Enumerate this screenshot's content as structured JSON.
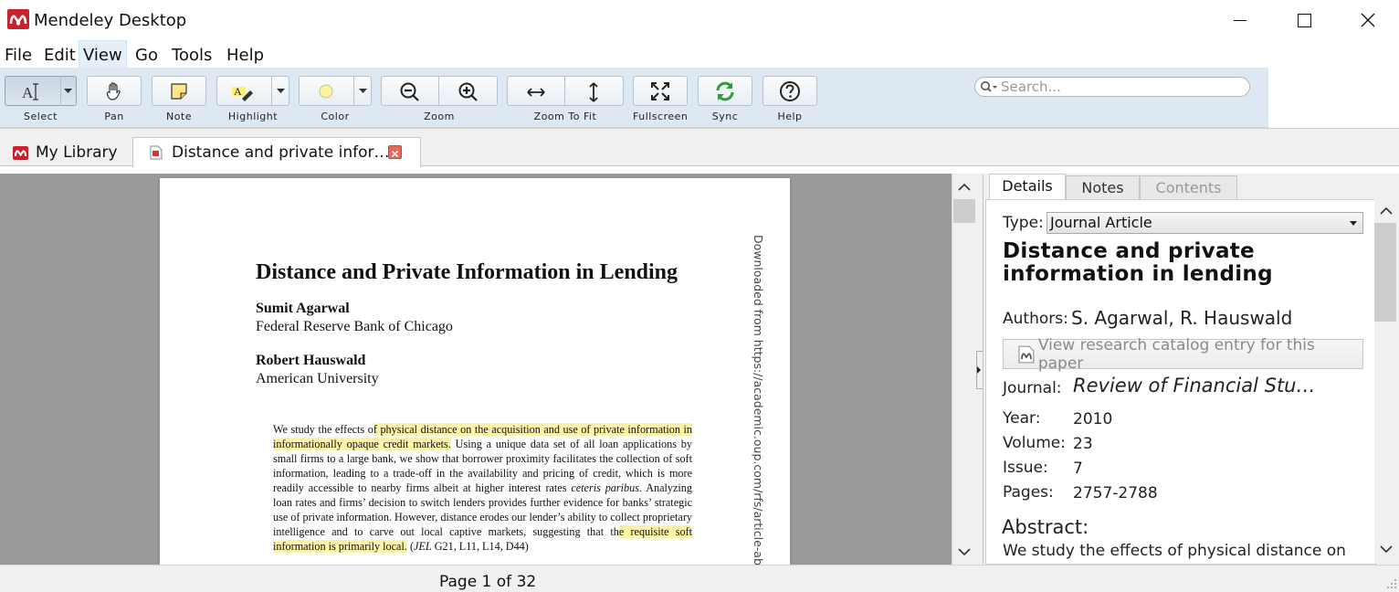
{
  "window": {
    "title": "Mendeley Desktop",
    "minimize_glyph": "─",
    "maximize_glyph": "☐",
    "close_glyph": "✕"
  },
  "menu": {
    "items": [
      "File",
      "Edit",
      "View",
      "Go",
      "Tools",
      "Help"
    ],
    "active": "View"
  },
  "toolbar": {
    "select": "Select",
    "pan": "Pan",
    "note": "Note",
    "highlight": "Highlight",
    "color": "Color",
    "zoom": "Zoom",
    "zoom_to_fit": "Zoom To Fit",
    "fullscreen": "Fullscreen",
    "sync": "Sync",
    "help": "Help",
    "highlight_color": "#fff3a0",
    "sync_color": "#2e9c3a"
  },
  "search": {
    "placeholder": "Search..."
  },
  "tabs": {
    "library": "My Library",
    "document": "Distance and private infor…"
  },
  "document": {
    "title": "Distance and Private Information in Lending",
    "author1_name": "Sumit Agarwal",
    "author1_affil": "Federal Reserve Bank of Chicago",
    "author2_name": "Robert Hauswald",
    "author2_affil": "American University",
    "abstract": {
      "a1": "We study the effects o",
      "h1": "f physical distance on the acquisition and use of private information in informationally opaque credit markets.",
      "a2": " Using a unique data set of all loan applications by small firms to a large bank, we show that borrower proximity facilitates the collection of soft information, leading to a trade-off in the availability and pricing of credit, which is more readily accessible to nearby firms albeit at higher interest rates ",
      "a2i": "ceteris paribus",
      "a3": ". Analyzing loan rates and firms’ decision to switch lenders provides further evidence for banks’ strategic use of private information. However, distance erodes our lender’s ability to collect proprietary intelligence and to carve out local captive markets, suggesting that th",
      "h2": "e requisite soft information is primarily local.",
      "a4": " (",
      "a4i": "JEL",
      "a5": " G21, L11, L14, D44)"
    },
    "side_watermark": "Downloaded from https://academic.oup.com/rfs/article-abstract/"
  },
  "status": {
    "page": "Page 1 of 32"
  },
  "details": {
    "tabs": [
      "Details",
      "Notes",
      "Contents"
    ],
    "type_label": "Type:",
    "type_value": "Journal Article",
    "title": "Distance and private information in lending",
    "authors_label": "Authors:",
    "authors_value": "S. Agarwal, R. Hauswald",
    "catalog_button": "View research catalog entry for this paper",
    "journal_label": "Journal:",
    "journal_value": "Review of Financial Stu…",
    "year_label": "Year:",
    "year_value": "2010",
    "volume_label": "Volume:",
    "volume_value": "23",
    "issue_label": "Issue:",
    "issue_value": "7",
    "pages_label": "Pages:",
    "pages_value": "2757-2788",
    "abstract_label": "Abstract:",
    "abstract_value": "We study the effects of physical distance on"
  }
}
